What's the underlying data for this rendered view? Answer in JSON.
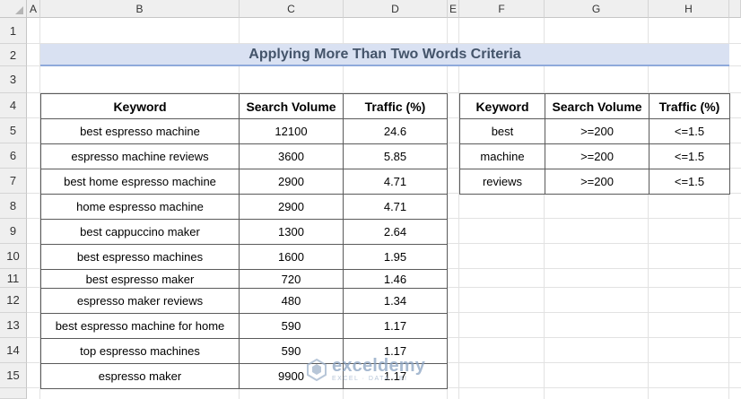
{
  "spreadsheet": {
    "columns": [
      "A",
      "B",
      "C",
      "D",
      "E",
      "F",
      "G",
      "H"
    ],
    "rows": [
      "1",
      "2",
      "3",
      "4",
      "5",
      "6",
      "7",
      "8",
      "9",
      "10",
      "11",
      "12",
      "13",
      "14",
      "15"
    ]
  },
  "title": "Applying More Than Two Words Criteria",
  "main_table": {
    "headers": [
      "Keyword",
      "Search Volume",
      "Traffic (%)"
    ],
    "rows": [
      [
        "best espresso machine",
        "12100",
        "24.6"
      ],
      [
        "espresso machine reviews",
        "3600",
        "5.85"
      ],
      [
        "best home espresso machine",
        "2900",
        "4.71"
      ],
      [
        "home espresso machine",
        "2900",
        "4.71"
      ],
      [
        "best cappuccino maker",
        "1300",
        "2.64"
      ],
      [
        "best espresso machines",
        "1600",
        "1.95"
      ],
      [
        "best espresso maker",
        "720",
        "1.46"
      ],
      [
        "espresso maker reviews",
        "480",
        "1.34"
      ],
      [
        "best espresso machine for home",
        "590",
        "1.17"
      ],
      [
        "top espresso machines",
        "590",
        "1.17"
      ],
      [
        "espresso maker",
        "9900",
        "1.17"
      ]
    ]
  },
  "criteria_table": {
    "headers": [
      "Keyword",
      "Search Volume",
      "Traffic (%)"
    ],
    "rows": [
      [
        "best",
        ">=200",
        "<=1.5"
      ],
      [
        "machine",
        ">=200",
        "<=1.5"
      ],
      [
        "reviews",
        ">=200",
        "<=1.5"
      ]
    ]
  },
  "watermark": {
    "name": "exceldemy",
    "tagline": "EXCEL · DATA · BI",
    "color": "#8aa3c2"
  },
  "colors": {
    "title_fill": "#d9e1f2",
    "title_text": "#44546a",
    "title_border": "#8ea9db",
    "header_bg": "#efefef"
  }
}
